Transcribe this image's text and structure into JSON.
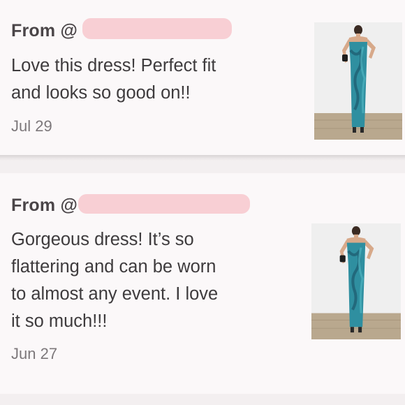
{
  "reviews": [
    {
      "from_label": "From @",
      "message": "Love this dress! Perfect fit\nand looks so good on!!",
      "date": "Jul 29",
      "photo_icon": "dress-photo"
    },
    {
      "from_label": "From @",
      "message": "Gorgeous dress! It’s so\nflattering and can be worn\nto almost any event. I love\nit so much!!!",
      "date": "Jun 27",
      "photo_icon": "dress-photo"
    }
  ],
  "colors": {
    "card_bg": "#fbf8f9",
    "redaction": "#f8cfd4",
    "dress": "#2f8fa0"
  }
}
